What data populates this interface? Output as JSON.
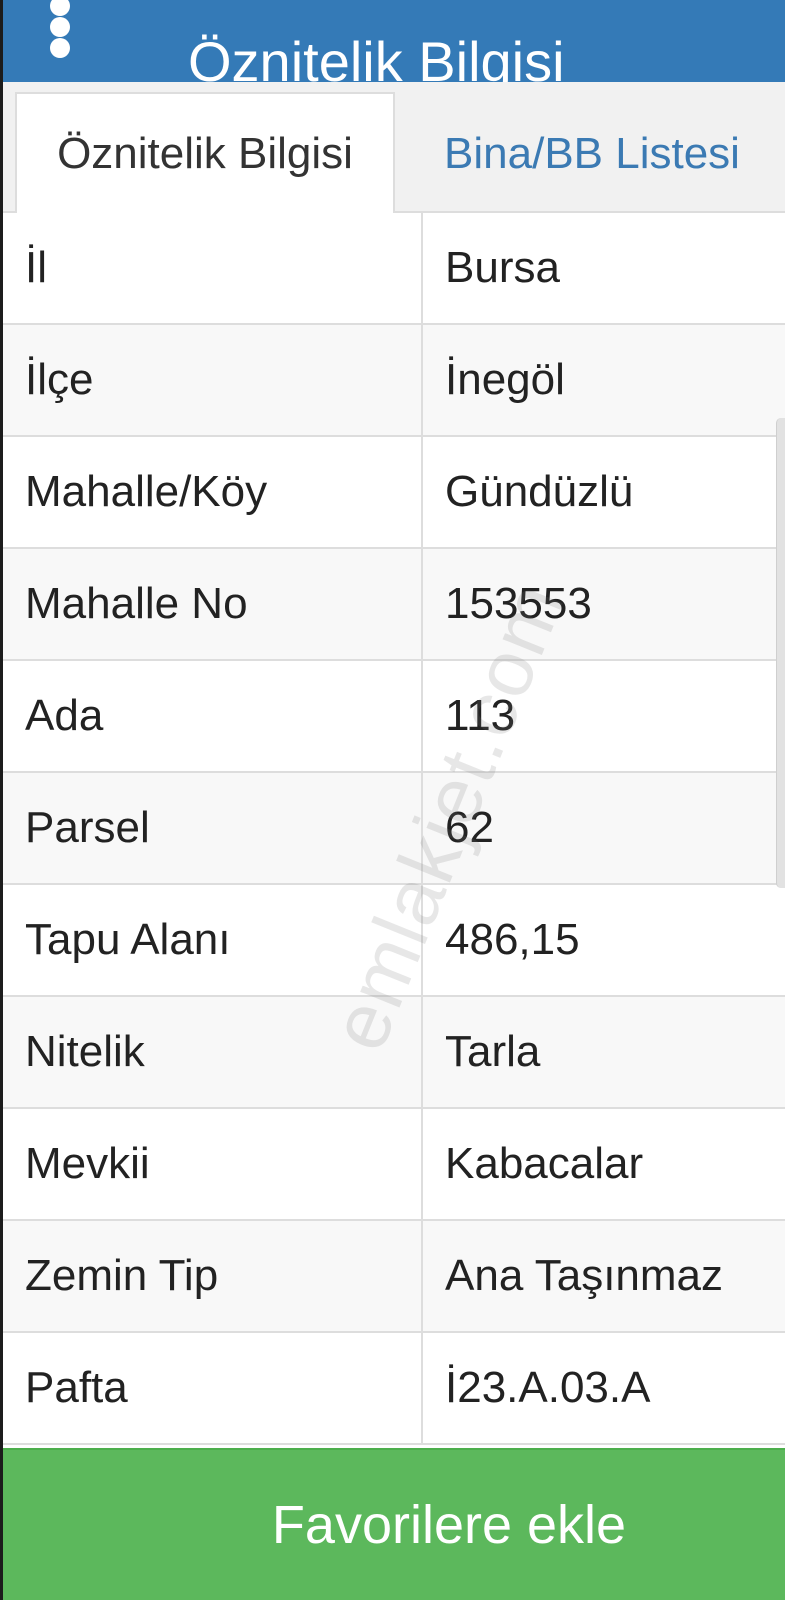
{
  "header": {
    "title": "Öznitelik Bilgisi",
    "menu_icon": "vertical-dots-icon"
  },
  "tabs": [
    {
      "label": "Öznitelik Bilgisi",
      "active": true
    },
    {
      "label": "Bina/BB Listesi",
      "active": false
    }
  ],
  "attributes": [
    {
      "label": "İl",
      "value": "Bursa"
    },
    {
      "label": "İlçe",
      "value": "İnegöl"
    },
    {
      "label": "Mahalle/Köy",
      "value": "Gündüzlü"
    },
    {
      "label": "Mahalle No",
      "value": "153553"
    },
    {
      "label": "Ada",
      "value": "113"
    },
    {
      "label": "Parsel",
      "value": "62"
    },
    {
      "label": "Tapu Alanı",
      "value": "486,15"
    },
    {
      "label": "Nitelik",
      "value": "Tarla"
    },
    {
      "label": "Mevkii",
      "value": "Kabacalar"
    },
    {
      "label": "Zemin Tip",
      "value": "Ana Taşınmaz"
    },
    {
      "label": "Pafta",
      "value": "İ23.A.03.A"
    }
  ],
  "watermark": "emlakjet.com",
  "footer": {
    "favorite_button_label": "Favorilere ekle"
  },
  "colors": {
    "header_bg": "#347ab7",
    "tab_link": "#3b7ab3",
    "button_bg": "#5cb85c"
  }
}
